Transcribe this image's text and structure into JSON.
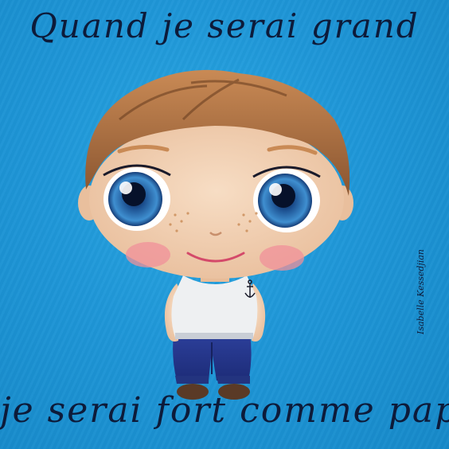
{
  "painting": {
    "title_top": "Quand je serai grand",
    "title_bottom": "je serai fort comme papa.",
    "signature": "Isabelle Kessedjian",
    "background_color": "#1f97d8",
    "text_color": "#0d1b3a"
  }
}
